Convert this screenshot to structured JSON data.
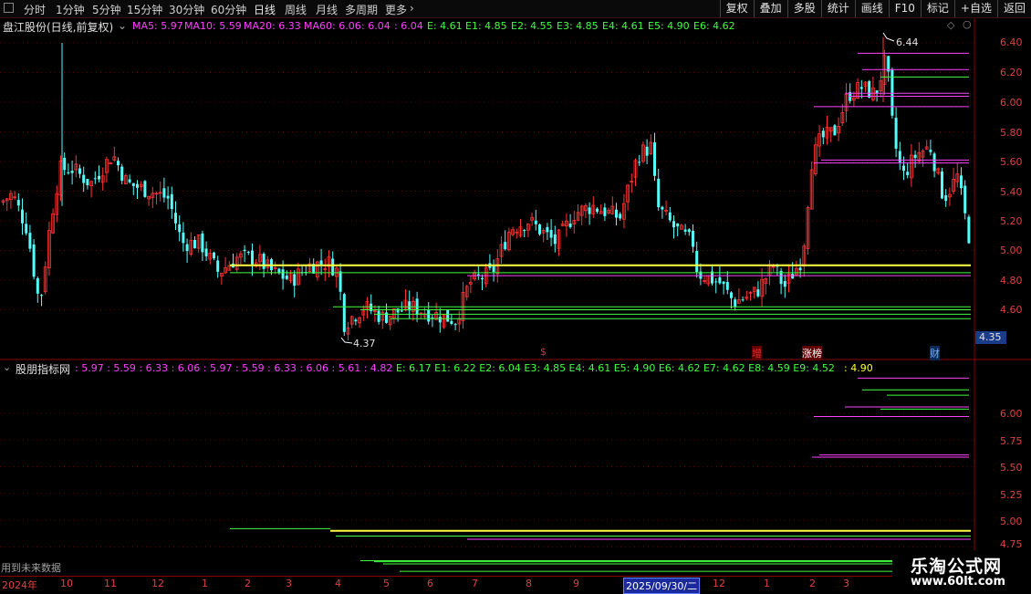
{
  "toolbar": {
    "timeframes": [
      "分时",
      "1分钟",
      "5分钟",
      "15分钟",
      "30分钟",
      "60分钟",
      "日线",
      "周线",
      "月线",
      "多周期",
      "更多"
    ],
    "active_timeframe": "日线",
    "tools": [
      "复权",
      "叠加",
      "多股",
      "统计",
      "画线",
      "F10",
      "标记",
      "+自选",
      "返回"
    ]
  },
  "main_header": {
    "title": "盘江股份(日线,前复权)",
    "ma5": "MA5: 5.97",
    "ma10": "MA10: 5.59",
    "ma20": "MA20: 6.33",
    "ma60": "MA60: 6.06",
    "extra1": ": 6.04",
    "extra2": ": 6.04",
    "e": "E: 4.61",
    "e1": "E1: 4.85",
    "e2": "E2: 4.55",
    "e3": "E3: 4.85",
    "e4": "E4: 4.61",
    "e5": "E5: 4.90",
    "e6": "E6: 4.62"
  },
  "price_labels": [
    "6.40",
    "6.20",
    "6.00",
    "5.80",
    "5.60",
    "5.40",
    "5.20",
    "5.00",
    "4.80",
    "4.60"
  ],
  "annotations": {
    "high": "6.44",
    "low": "4.37",
    "current_price": "4.35"
  },
  "event_markers": [
    {
      "text": "$",
      "color": "#e03030"
    },
    {
      "text": "增",
      "color": "#e03030"
    },
    {
      "text": "涨榜",
      "color": "#ffffff"
    },
    {
      "text": "财",
      "color": "#7ab0ff"
    }
  ],
  "indicator_header": {
    "title": "股朋指标网",
    "magenta_values": ": 5.97 : 5.59 : 6.33 : 6.06 : 5.97 : 5.59 : 6.33 : 6.06 : 5.61 : 4.82",
    "green_values": "E: 6.17  E1: 6.22  E2: 6.04  E3: 4.85  E4: 4.61  E5: 4.90  E6: 4.62  E7: 4.62  E8: 4.59  E9: 4.52",
    "yellow_value": ": 4.90"
  },
  "indicator_labels": [
    "6.00",
    "5.75",
    "5.50",
    "5.25",
    "5.00",
    "4.75"
  ],
  "future_data_note": "用到未来数据",
  "time_ticks": [
    "2024年",
    "10",
    "11",
    "12",
    "1",
    "2",
    "3",
    "4",
    "5",
    "6",
    "7",
    "8",
    "9",
    "2025/09/30/二",
    "12",
    "1",
    "2",
    "3"
  ],
  "watermark": {
    "line1": "乐淘公式网",
    "line2": "www.60lt.com"
  },
  "colors": {
    "up": "#ff3232",
    "down": "#54fcfc",
    "ma5": "#ffffff",
    "magenta": "#ff40ff",
    "green": "#40ff40",
    "yellow": "#ffff40",
    "axis": "#8b0000",
    "price_label": "#e04040"
  }
}
